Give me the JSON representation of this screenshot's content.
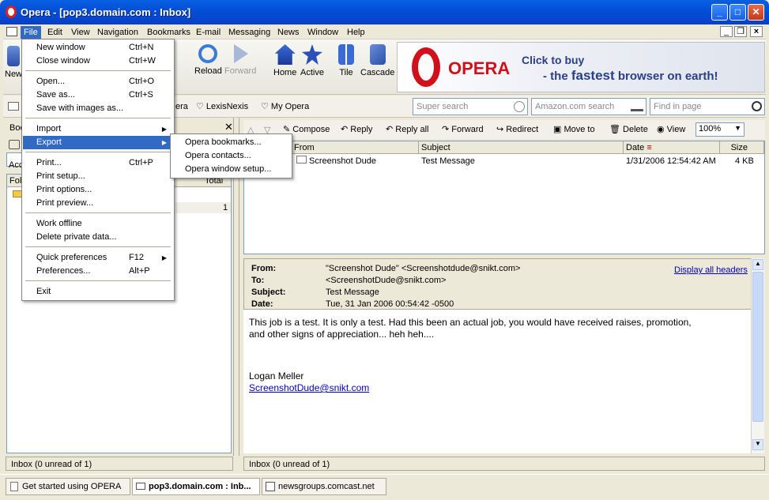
{
  "window": {
    "title": "Opera - [pop3.domain.com : Inbox]"
  },
  "menubar": [
    "File",
    "Edit",
    "View",
    "Navigation",
    "Bookmarks",
    "E-mail",
    "Messaging",
    "News",
    "Window",
    "Help"
  ],
  "toolbar": {
    "new_label": "New",
    "reload_label": "Reload",
    "forward_label": "Forward",
    "home_label": "Home",
    "active_label": "Active",
    "tile_label": "Tile",
    "cascade_label": "Cascade"
  },
  "ad": {
    "brand": "OPERA",
    "line1": "Click to buy",
    "line2_pre": "- the ",
    "line2_bold": "fastest",
    "line2_post": " browser on earth!"
  },
  "personalbar": {
    "item_opera_partial": "era",
    "lexisnexis": "LexisNexis",
    "myopera": "My Opera"
  },
  "search": {
    "super": "Super search",
    "amazon": "Amazon.com search",
    "find": "Find in page"
  },
  "leftpanel": {
    "tab_partial": "Boo",
    "acc_partial": "Acc",
    "fol_partial": "Fol",
    "total_header": "Total",
    "total_value": "1",
    "status": "Inbox (0 unread of 1)"
  },
  "mailtoolbar": {
    "compose": "Compose",
    "reply": "Reply",
    "reply_all": "Reply all",
    "forward": "Forward",
    "redirect": "Redirect",
    "move_to": "Move to",
    "delete": "Delete",
    "view": "View",
    "zoom": "100%"
  },
  "list": {
    "headers": {
      "from": "From",
      "subject": "Subject",
      "date": "Date",
      "size": "Size"
    },
    "rows": [
      {
        "from": "Screenshot Dude",
        "subject": "Test Message",
        "date": "1/31/2006 12:54:42 AM",
        "size": "4 KB"
      }
    ]
  },
  "message": {
    "labels": {
      "from": "From:",
      "to": "To:",
      "subject": "Subject:",
      "date": "Date:"
    },
    "from": "\"Screenshot Dude\" <Screenshotdude@snikt.com>",
    "to": "<ScreenshotDude@snikt.com>",
    "subject": "Test Message",
    "date": "Tue, 31 Jan 2006 00:54:42 -0500",
    "display_all_headers": "Display all headers",
    "body_line1": "This job is a test.  It is only a test.  Had this been an actual job, you would have received raises, promotion,",
    "body_line2": "and other signs of appreciation... heh heh....",
    "signature": "Logan Meller",
    "email_link": "ScreenshotDude@snikt.com",
    "status": "Inbox (0 unread of 1)"
  },
  "filemenu": {
    "items": [
      {
        "label": "New window",
        "shortcut": "Ctrl+N"
      },
      {
        "label": "Close window",
        "shortcut": "Ctrl+W"
      },
      {
        "label": "Open...",
        "shortcut": "Ctrl+O"
      },
      {
        "label": "Save as...",
        "shortcut": "Ctrl+S"
      },
      {
        "label": "Save with images as...",
        "shortcut": ""
      },
      {
        "label": "Import",
        "shortcut": ""
      },
      {
        "label": "Export",
        "shortcut": ""
      },
      {
        "label": "Print...",
        "shortcut": "Ctrl+P"
      },
      {
        "label": "Print setup...",
        "shortcut": ""
      },
      {
        "label": "Print options...",
        "shortcut": ""
      },
      {
        "label": "Print preview...",
        "shortcut": ""
      },
      {
        "label": "Work offline",
        "shortcut": ""
      },
      {
        "label": "Delete private data...",
        "shortcut": ""
      },
      {
        "label": "Quick preferences",
        "shortcut": "F12"
      },
      {
        "label": "Preferences...",
        "shortcut": "Alt+P"
      },
      {
        "label": "Exit",
        "shortcut": ""
      }
    ]
  },
  "submenu": {
    "items": [
      "Opera bookmarks...",
      "Opera contacts...",
      "Opera window setup..."
    ]
  },
  "tabs": [
    "Get started using OPERA",
    "pop3.domain.com : Inb...",
    "newsgroups.comcast.net"
  ]
}
